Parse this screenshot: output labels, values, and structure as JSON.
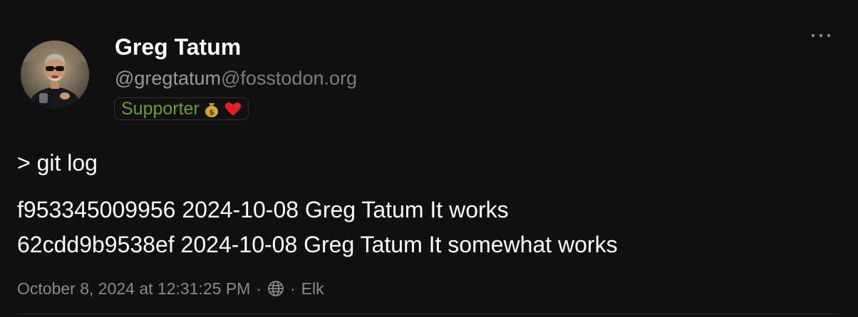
{
  "post": {
    "author": {
      "display_name": "Greg Tatum",
      "handle_user": "@gregtatum",
      "handle_domain": "@fosstodon.org",
      "badge_label": "Supporter",
      "badge_icons": [
        "money-bag-icon",
        "red-heart-icon"
      ],
      "avatar": "avatar-photo"
    },
    "more_icon": "ellipsis-icon",
    "content": {
      "line_1": "> git log",
      "line_2": "f953345009956 2024-10-08 Greg Tatum It works",
      "line_3": "62cdd9b9538ef 2024-10-08 Greg Tatum It somewhat works"
    },
    "meta": {
      "timestamp": "October 8, 2024 at 12:31:25 PM",
      "separator": "·",
      "visibility_icon": "globe-icon",
      "client": "Elk"
    }
  },
  "colors": {
    "background": "#101010",
    "text": "#ffffff",
    "muted": "#8a8a8a",
    "badge_green": "#6e9a3c"
  }
}
